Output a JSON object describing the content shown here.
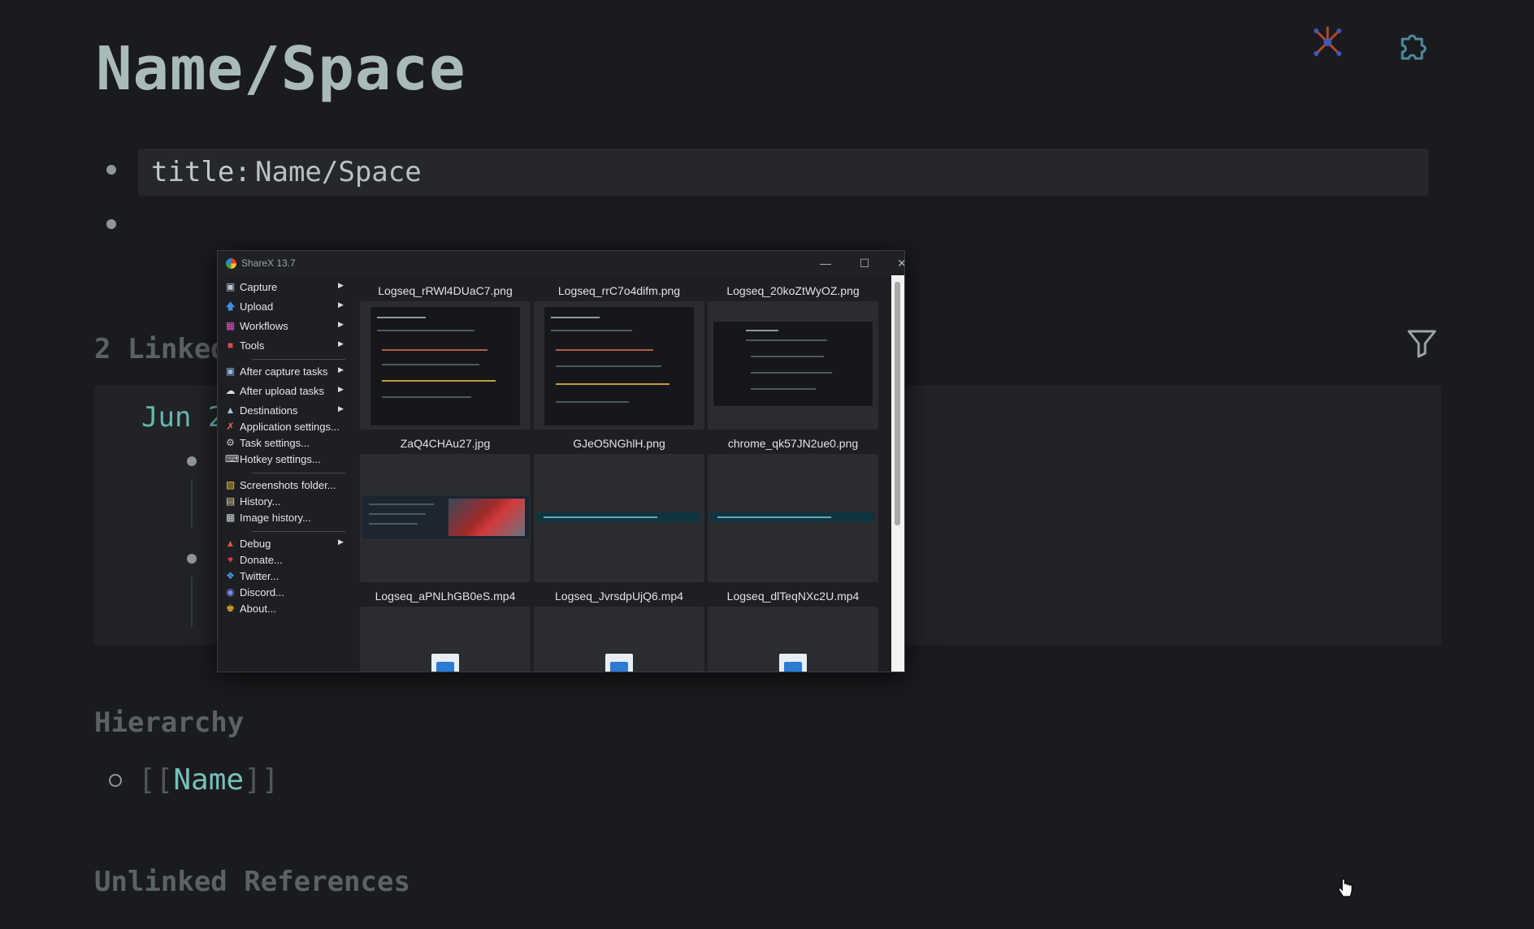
{
  "page": {
    "title": "Name/Space",
    "property_key": "title:",
    "property_value": "Name/Space",
    "linked_refs_heading": "2 Linked",
    "linked_date": "Jun 2",
    "hierarchy_heading": "Hierarchy",
    "hierarchy_open": "[[",
    "hierarchy_item": "Name",
    "hierarchy_close": "]]",
    "unlinked_heading": "Unlinked References",
    "icons": [
      "graph-icon",
      "puzzle-icon",
      "filter-icon"
    ]
  },
  "sharex": {
    "title": "ShareX 13.7",
    "menu": [
      {
        "label": "Capture",
        "icon": "capture-icon",
        "submenu": true
      },
      {
        "label": "Upload",
        "icon": "upload-icon",
        "submenu": true
      },
      {
        "label": "Workflows",
        "icon": "workflows-icon",
        "submenu": true
      },
      {
        "label": "Tools",
        "icon": "tools-icon",
        "submenu": true
      },
      {
        "label": "After capture tasks",
        "icon": "after-capture-icon",
        "submenu": true
      },
      {
        "label": "After upload tasks",
        "icon": "after-upload-icon",
        "submenu": true
      },
      {
        "label": "Destinations",
        "icon": "destinations-icon",
        "submenu": true
      },
      {
        "label": "Application settings...",
        "icon": "app-settings-icon",
        "submenu": false
      },
      {
        "label": "Task settings...",
        "icon": "task-settings-icon",
        "submenu": false
      },
      {
        "label": "Hotkey settings...",
        "icon": "hotkey-settings-icon",
        "submenu": false
      },
      {
        "label": "Screenshots folder...",
        "icon": "folder-icon",
        "submenu": false
      },
      {
        "label": "History...",
        "icon": "history-icon",
        "submenu": false
      },
      {
        "label": "Image history...",
        "icon": "image-history-icon",
        "submenu": false
      },
      {
        "label": "Debug",
        "icon": "debug-icon",
        "submenu": true
      },
      {
        "label": "Donate...",
        "icon": "heart-icon",
        "submenu": false
      },
      {
        "label": "Twitter...",
        "icon": "twitter-icon",
        "submenu": false
      },
      {
        "label": "Discord...",
        "icon": "discord-icon",
        "submenu": false
      },
      {
        "label": "About...",
        "icon": "crown-icon",
        "submenu": false
      }
    ],
    "files": [
      {
        "name": "Logseq_rRWl4DUaC7.png",
        "preview": "logseq-screenshot"
      },
      {
        "name": "Logseq_rrC7o4difm.png",
        "preview": "logseq-screenshot"
      },
      {
        "name": "Logseq_20koZtWyOZ.png",
        "preview": "logseq-screenshot-small"
      },
      {
        "name": "ZaQ4CHAu27.jpg",
        "preview": "photo-screenshot"
      },
      {
        "name": "GJeO5NGhlH.png",
        "preview": "file-path-strip"
      },
      {
        "name": "chrome_qk57JN2ue0.png",
        "preview": "file-path-strip"
      },
      {
        "name": "Logseq_aPNLhGB0eS.mp4",
        "preview": "video-file-icon"
      },
      {
        "name": "Logseq_JvrsdpUjQ6.mp4",
        "preview": "video-file-icon"
      },
      {
        "name": "Logseq_dlTeqNXc2U.mp4",
        "preview": "video-file-icon"
      }
    ]
  }
}
